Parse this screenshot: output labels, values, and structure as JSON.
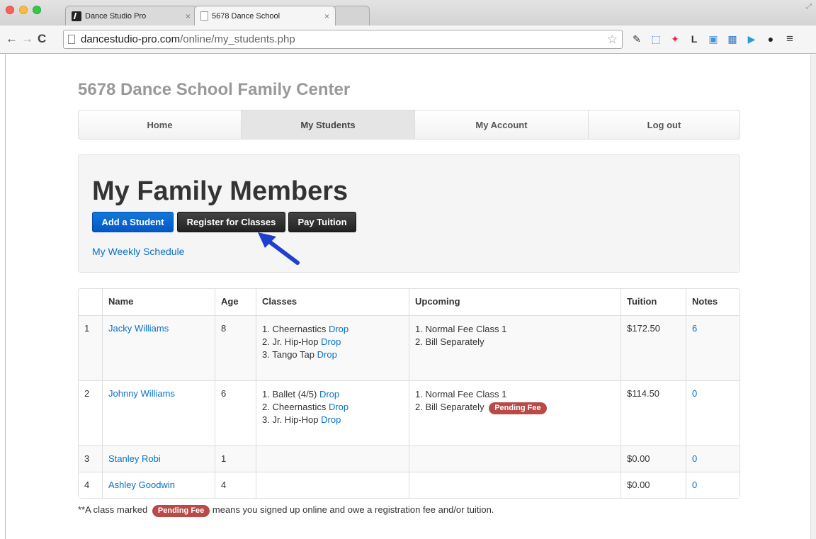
{
  "browser": {
    "tabs": [
      {
        "title": "Dance Studio Pro",
        "close": "×"
      },
      {
        "title": "5678 Dance School",
        "close": "×"
      }
    ],
    "url_host": "dancestudio-pro.com",
    "url_path": "/online/my_students.php",
    "nav": {
      "back": "←",
      "forward": "→",
      "reload": "C"
    },
    "star": "☆",
    "extensions": [
      {
        "icon": "eyedropper-icon",
        "glyph": "✎"
      },
      {
        "icon": "screen-capture-icon",
        "glyph": "⬚"
      },
      {
        "icon": "color-wheel-icon",
        "glyph": "✦"
      },
      {
        "icon": "l-extension-icon",
        "glyph": "L"
      },
      {
        "icon": "window-icon",
        "glyph": "▣"
      },
      {
        "icon": "image-icon",
        "glyph": "▩"
      },
      {
        "icon": "play-icon",
        "glyph": "▶"
      },
      {
        "icon": "circle-icon",
        "glyph": "●"
      },
      {
        "icon": "menu-icon",
        "glyph": "≡"
      }
    ]
  },
  "site": {
    "title": "5678 Dance School Family Center"
  },
  "nav": {
    "items": [
      {
        "label": "Home"
      },
      {
        "label": "My Students"
      },
      {
        "label": "My Account"
      },
      {
        "label": "Log out"
      }
    ]
  },
  "hero": {
    "heading": "My Family Members",
    "buttons": {
      "add_student": "Add a Student",
      "register": "Register for Classes",
      "pay": "Pay Tuition"
    },
    "schedule_link": "My Weekly Schedule"
  },
  "table": {
    "headers": [
      "",
      "Name",
      "Age",
      "Classes",
      "Upcoming",
      "Tuition",
      "Notes"
    ],
    "rows": [
      {
        "num": "1",
        "name": "Jacky Williams",
        "age": "8",
        "classes": [
          {
            "n": "1.",
            "name": "Cheernastics",
            "action": "Drop"
          },
          {
            "n": "2.",
            "name": "Jr. Hip-Hop",
            "action": "Drop"
          },
          {
            "n": "3.",
            "name": "Tango Tap",
            "action": "Drop"
          }
        ],
        "upcoming": [
          {
            "n": "1.",
            "text": "Normal Fee Class 1"
          },
          {
            "n": "2.",
            "text": "Bill Separately"
          }
        ],
        "tuition": "$172.50",
        "notes": "6"
      },
      {
        "num": "2",
        "name": "Johnny Williams",
        "age": "6",
        "classes": [
          {
            "n": "1.",
            "name": "Ballet (4/5)",
            "action": "Drop"
          },
          {
            "n": "2.",
            "name": "Cheernastics",
            "action": "Drop"
          },
          {
            "n": "3.",
            "name": "Jr. Hip-Hop",
            "action": "Drop"
          }
        ],
        "upcoming": [
          {
            "n": "1.",
            "text": "Normal Fee Class 1"
          },
          {
            "n": "2.",
            "text": "Bill Separately",
            "badge": "Pending Fee"
          }
        ],
        "tuition": "$114.50",
        "notes": "0"
      },
      {
        "num": "3",
        "name": "Stanley Robi",
        "age": "1",
        "tuition": "$0.00",
        "notes": "0"
      },
      {
        "num": "4",
        "name": "Ashley Goodwin",
        "age": "4",
        "tuition": "$0.00",
        "notes": "0"
      }
    ]
  },
  "footnote": {
    "before": "**A class marked",
    "badge": "Pending Fee",
    "after": "means you signed up online and owe a registration fee and/or tuition."
  },
  "colors": {
    "primary": "#0557c8",
    "link": "#0a71c8",
    "badge": "#b94a48",
    "arrow": "#1f3fd0"
  }
}
